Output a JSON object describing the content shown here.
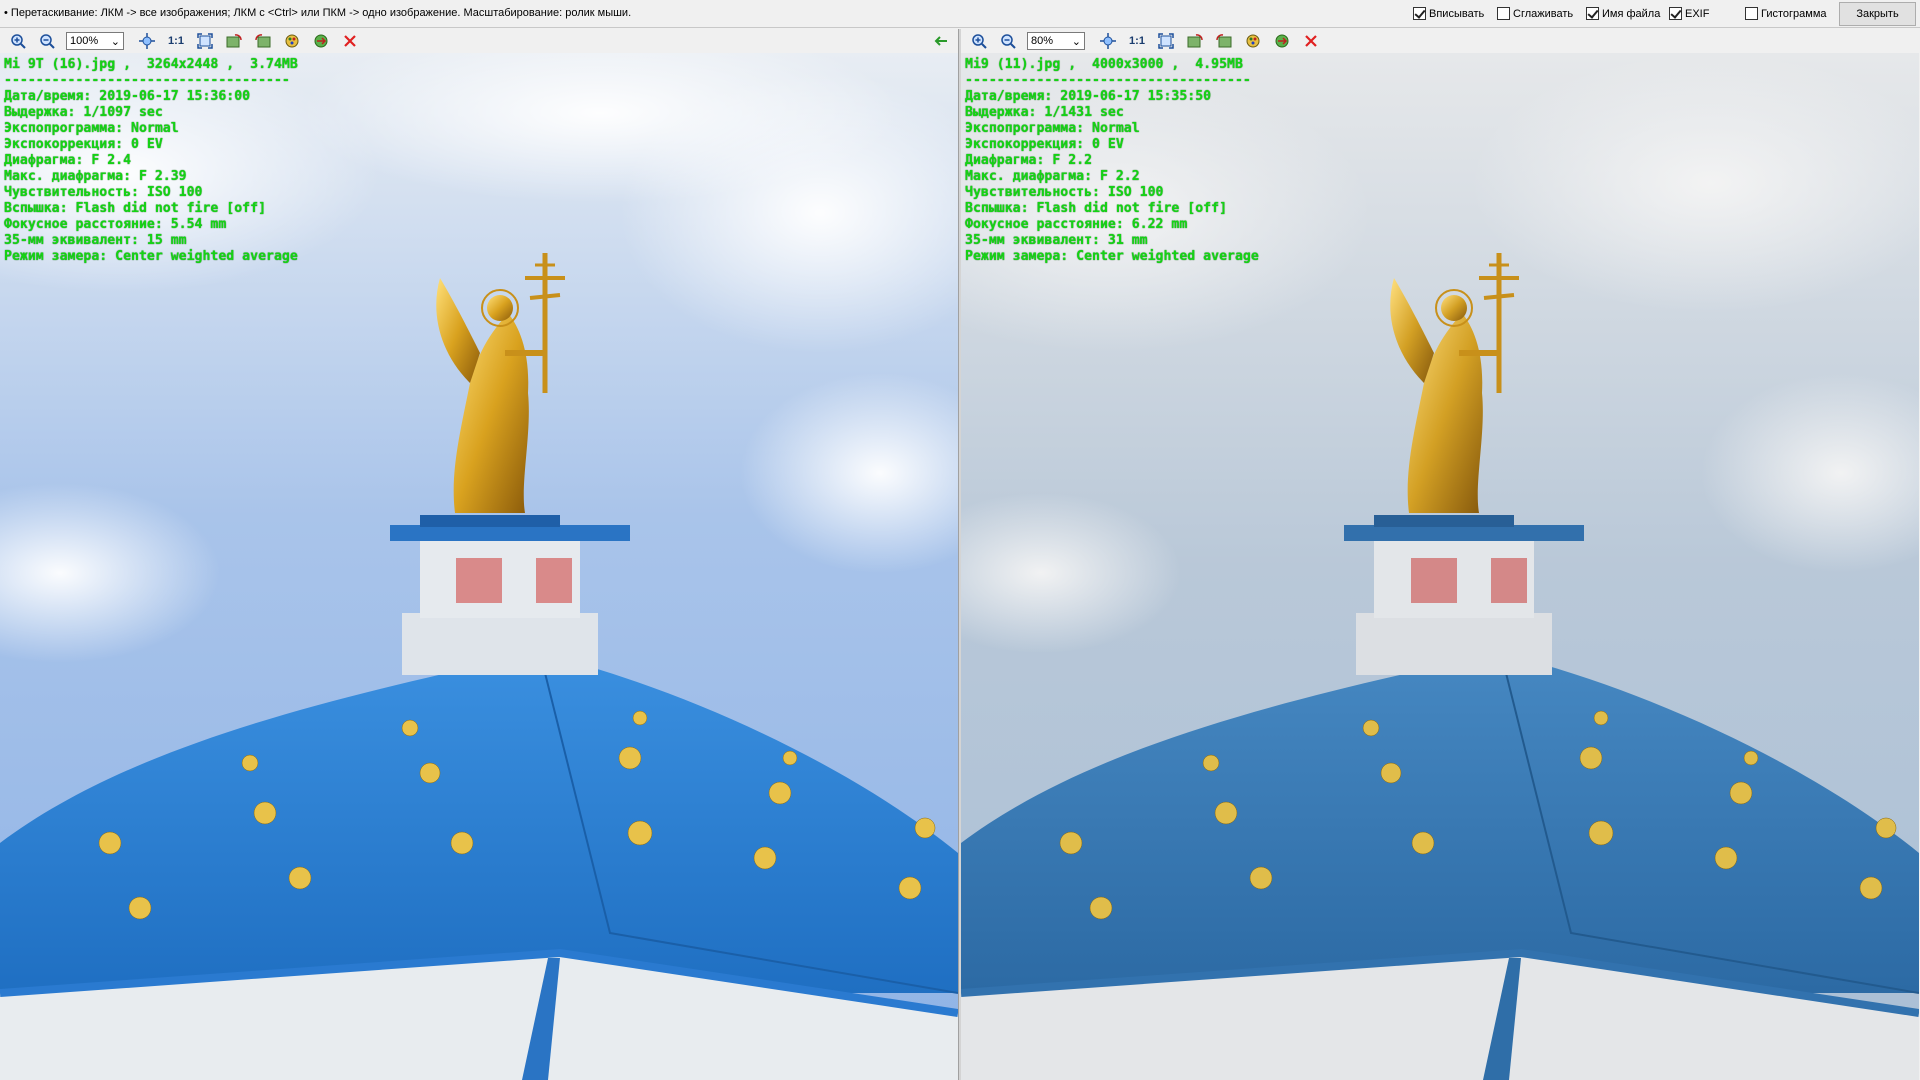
{
  "hint": "• Перетаскивание: ЛКМ -> все изображения; ЛКМ с <Ctrl> или ПКМ -> одно изображение. Масштабирование: ролик мыши.",
  "options": [
    {
      "label": "Вписывать",
      "checked": true
    },
    {
      "label": "Сглаживать",
      "checked": false
    },
    {
      "label": "Имя файла",
      "checked": true
    },
    {
      "label": "EXIF",
      "checked": true
    },
    {
      "label": "Гистограмма",
      "checked": false
    }
  ],
  "close_label": "Закрыть",
  "colors": {
    "exif_text": "#14d414",
    "sky_left": "#9fbde6",
    "sky_right": "#b7c6d6",
    "dome_left": "#2f86d6",
    "dome_right": "#3c7fb8",
    "gold": "#d9a21f",
    "close_x": "#e02020"
  },
  "icons": [
    "zoom-in-icon",
    "zoom-out-icon",
    "fit-icon",
    "one-to-one-icon",
    "fullscreen-icon",
    "rotate-left-icon",
    "rotate-right-icon",
    "palette-icon",
    "refresh-icon",
    "close-x-icon",
    "back-arrow-icon"
  ],
  "panels": [
    {
      "zoom": "100%",
      "one_to_one": "1:1",
      "file_line": "Mi 9T (16).jpg ,  3264x2448 ,  3.74MB",
      "separator": "------------------------------------",
      "exif": [
        "Дата/время: 2019-06-17 15:36:00",
        "Выдержка: 1/1097 sec",
        "Экспопрограмма: Normal",
        "Экспокоррекция: 0 EV",
        "Диафрагма: F 2.4",
        "Макс. диафрагма: F 2.39",
        "Чувствительность: ISO 100",
        "Вспышка: Flash did not fire [off]",
        "Фокусное расстояние: 5.54 mm",
        "35-мм эквивалент: 15 mm",
        "Режим замера: Center weighted average"
      ]
    },
    {
      "zoom": "80%",
      "one_to_one": "1:1",
      "file_line": "Mi9 (11).jpg ,  4000x3000 ,  4.95MB",
      "separator": "------------------------------------",
      "exif": [
        "Дата/время: 2019-06-17 15:35:50",
        "Выдержка: 1/1431 sec",
        "Экспопрограмма: Normal",
        "Экспокоррекция: 0 EV",
        "Диафрагма: F 2.2",
        "Макс. диафрагма: F 2.2",
        "Чувствительность: ISO 100",
        "Вспышка: Flash did not fire [off]",
        "Фокусное расстояние: 6.22 mm",
        "35-мм эквивалент: 31 mm",
        "Режим замера: Center weighted average"
      ]
    }
  ]
}
